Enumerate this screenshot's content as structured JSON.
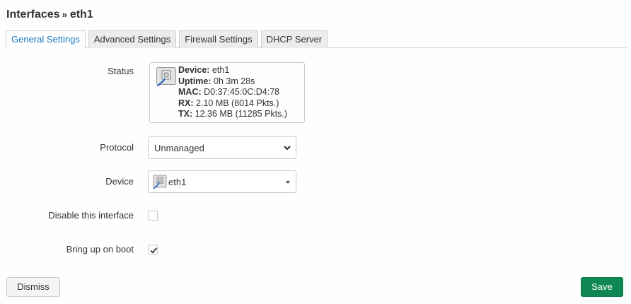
{
  "header": {
    "title": "Interfaces",
    "separator": "»",
    "subtitle": "eth1"
  },
  "tabs": [
    {
      "label": "General Settings",
      "active": true
    },
    {
      "label": "Advanced Settings",
      "active": false
    },
    {
      "label": "Firewall Settings",
      "active": false
    },
    {
      "label": "DHCP Server",
      "active": false
    }
  ],
  "form": {
    "status": {
      "label": "Status",
      "icon": "ethernet-port-icon",
      "device_key": "Device:",
      "device_value": "eth1",
      "uptime_key": "Uptime:",
      "uptime_value": "0h 3m 28s",
      "mac_key": "MAC:",
      "mac_value": "D0:37:45:0C:D4:78",
      "rx_key": "RX:",
      "rx_value": "2.10 MB (8014 Pkts.)",
      "tx_key": "TX:",
      "tx_value": "12.36 MB (11285 Pkts.)"
    },
    "protocol": {
      "label": "Protocol",
      "value": "Unmanaged"
    },
    "device": {
      "label": "Device",
      "value": "eth1",
      "icon": "ethernet-port-icon"
    },
    "disable_interface": {
      "label": "Disable this interface",
      "checked": false
    },
    "bring_up_on_boot": {
      "label": "Bring up on boot",
      "checked": true
    }
  },
  "buttons": {
    "dismiss": "Dismiss",
    "save": "Save"
  },
  "colors": {
    "accent": "#1a78c2",
    "save": "#0e8754"
  }
}
